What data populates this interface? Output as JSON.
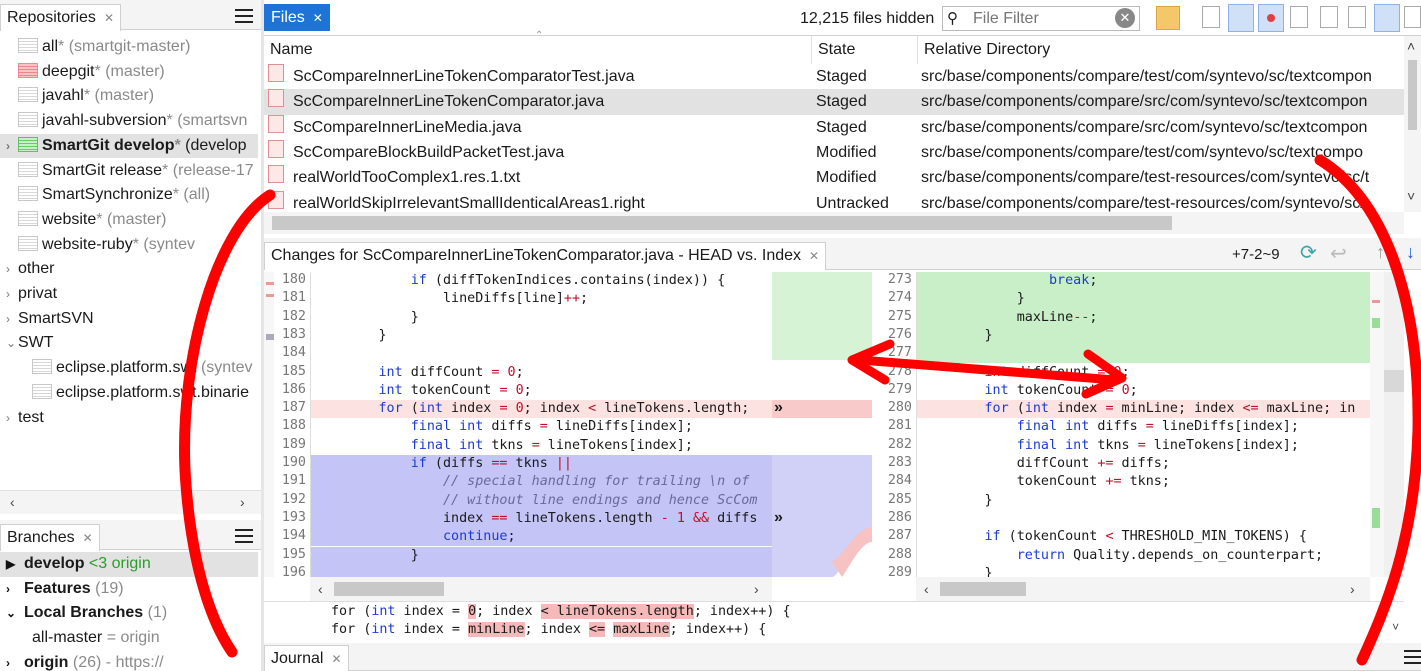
{
  "repositories": {
    "tab_label": "Repositories",
    "items": [
      {
        "name": "all",
        "star": "*",
        "branch": "(smartgit-master)",
        "icon": "repo-icon",
        "indent": 1
      },
      {
        "name": "deepgit",
        "star": "*",
        "branch": "(master)",
        "icon": "repo-icon-red",
        "indent": 1
      },
      {
        "name": "javahl",
        "star": "*",
        "branch": "(master)",
        "icon": "repo-icon",
        "indent": 1
      },
      {
        "name": "javahl-subversion",
        "star": "*",
        "branch": "(smartsvn",
        "icon": "repo-icon",
        "indent": 1
      },
      {
        "name": "SmartGit develop",
        "star": "*",
        "branch": "(develop",
        "icon": "repo-icon-green",
        "indent": 1,
        "selected": true
      },
      {
        "name": "SmartGit release",
        "star": "*",
        "branch": "(release-17",
        "icon": "repo-icon",
        "indent": 1
      },
      {
        "name": "SmartSynchronize",
        "star": "*",
        "branch": "(all)",
        "icon": "repo-icon",
        "indent": 1
      },
      {
        "name": "website",
        "star": "*",
        "branch": "(master)",
        "icon": "repo-icon",
        "indent": 1
      },
      {
        "name": "website-ruby",
        "star": "*",
        "branch": "(syntev",
        "icon": "repo-icon",
        "indent": 1
      },
      {
        "name": "other",
        "star": "",
        "branch": "",
        "icon": "chevron-right-icon",
        "indent": 0
      },
      {
        "name": "privat",
        "star": "",
        "branch": "",
        "icon": "chevron-right-icon",
        "indent": 0
      },
      {
        "name": "SmartSVN",
        "star": "",
        "branch": "",
        "icon": "chevron-right-icon",
        "indent": 0
      },
      {
        "name": "SWT",
        "star": "",
        "branch": "",
        "icon": "chevron-down-icon",
        "indent": 0
      },
      {
        "name": "eclipse.platform.swt",
        "star": "",
        "branch": "(syntev",
        "icon": "repo-icon",
        "indent": 2
      },
      {
        "name": "eclipse.platform.swt.binarie",
        "star": "",
        "branch": "",
        "icon": "repo-icon",
        "indent": 2
      },
      {
        "name": "test",
        "star": "",
        "branch": "",
        "icon": "chevron-right-icon",
        "indent": 0
      }
    ]
  },
  "branches": {
    "tab_label": "Branches",
    "items": [
      {
        "marker": "▶",
        "name": "develop",
        "suffix": "<3 origin",
        "bold": true
      },
      {
        "marker": "›",
        "name": "Features",
        "suffix": "(19)",
        "bold": true
      },
      {
        "marker": "⌄",
        "name": "Local Branches",
        "suffix": "(1)",
        "bold": true
      },
      {
        "marker": "",
        "name": "all-master",
        "suffix": "= origin",
        "bold": false
      },
      {
        "marker": "›",
        "name": "origin",
        "suffix": "(26) - https://",
        "bold": true
      }
    ]
  },
  "files": {
    "tab_label": "Files",
    "hidden_count": "12,215 files hidden",
    "filter_placeholder": "File Filter",
    "columns": [
      "Name",
      "State",
      "Relative Directory"
    ],
    "rows": [
      {
        "name": "ScCompareInnerLineTokenComparatorTest.java",
        "state": "Staged",
        "dir": "src/base/components/compare/test/com/syntevo/sc/textcompon"
      },
      {
        "name": "ScCompareInnerLineTokenComparator.java",
        "state": "Staged",
        "dir": "src/base/components/compare/src/com/syntevo/sc/textcompon",
        "selected": true
      },
      {
        "name": "ScCompareInnerLineMedia.java",
        "state": "Staged",
        "dir": "src/base/components/compare/src/com/syntevo/sc/textcompon"
      },
      {
        "name": "ScCompareBlockBuildPacketTest.java",
        "state": "Modified",
        "dir": "src/base/components/compare/test/com/syntevo/sc/textcompo"
      },
      {
        "name": "realWorldTooComplex1.res.1.txt",
        "state": "Modified",
        "dir": "src/base/components/compare/test-resources/com/syntevo/sc/t"
      },
      {
        "name": "realWorldSkipIrrelevantSmallIdenticalAreas1.right",
        "state": "Untracked",
        "dir": "src/base/components/compare/test-resources/com/syntevo/sc/t"
      }
    ]
  },
  "changes": {
    "title": "Changes for ScCompareInnerLineTokenComparator.java - HEAD vs. Index",
    "stats": "+7-2~9",
    "left_lines": [
      {
        "n": "180",
        "text": "            if (diffTokenIndices.contains(index)) {"
      },
      {
        "n": "181",
        "text": "                lineDiffs[line]++;"
      },
      {
        "n": "182",
        "text": "            }"
      },
      {
        "n": "183",
        "text": "        }"
      },
      {
        "n": "184",
        "text": ""
      },
      {
        "n": "185",
        "text": "        int diffCount = 0;"
      },
      {
        "n": "186",
        "text": "        int tokenCount = 0;"
      },
      {
        "n": "187",
        "text": "        for (int index = 0; index < lineTokens.length;"
      },
      {
        "n": "188",
        "text": "            final int diffs = lineDiffs[index];"
      },
      {
        "n": "189",
        "text": "            final int tkns = lineTokens[index];"
      },
      {
        "n": "190",
        "text": "            if (diffs == tkns ||"
      },
      {
        "n": "191",
        "text": "                // special handling for trailing \\n of"
      },
      {
        "n": "192",
        "text": "                // without line endings and hence ScCom"
      },
      {
        "n": "193",
        "text": "                index == lineTokens.length - 1 && diffs"
      },
      {
        "n": "194",
        "text": "                continue;"
      },
      {
        "n": "195",
        "text": "            }"
      },
      {
        "n": "196",
        "text": ""
      }
    ],
    "right_lines": [
      {
        "n": "273",
        "text": "                break;"
      },
      {
        "n": "274",
        "text": "            }"
      },
      {
        "n": "275",
        "text": "            maxLine--;"
      },
      {
        "n": "276",
        "text": "        }"
      },
      {
        "n": "277",
        "text": ""
      },
      {
        "n": "278",
        "text": "        int diffCount = 0;"
      },
      {
        "n": "279",
        "text": "        int tokenCount = 0;"
      },
      {
        "n": "280",
        "text": "        for (int index = minLine; index <= maxLine; in"
      },
      {
        "n": "281",
        "text": "            final int diffs = lineDiffs[index];"
      },
      {
        "n": "282",
        "text": "            final int tkns = lineTokens[index];"
      },
      {
        "n": "283",
        "text": "            diffCount += diffs;"
      },
      {
        "n": "284",
        "text": "            tokenCount += tkns;"
      },
      {
        "n": "285",
        "text": "        }"
      },
      {
        "n": "286",
        "text": ""
      },
      {
        "n": "287",
        "text": "        if (tokenCount < THRESHOLD_MIN_TOKENS) {"
      },
      {
        "n": "288",
        "text": "            return Quality.depends_on_counterpart;"
      },
      {
        "n": "289",
        "text": "        }"
      }
    ],
    "inline_left": "for (int index = 0; index < lineTokens.length; index++) {",
    "inline_right": "for (int index = minLine; index <= maxLine; index++) {"
  },
  "journal": {
    "tab_label": "Journal"
  },
  "colors": {
    "accent": "#1e74d6",
    "added": "#c8efc8",
    "removed": "#f6b9b9",
    "changed": "#c4c4f6"
  }
}
